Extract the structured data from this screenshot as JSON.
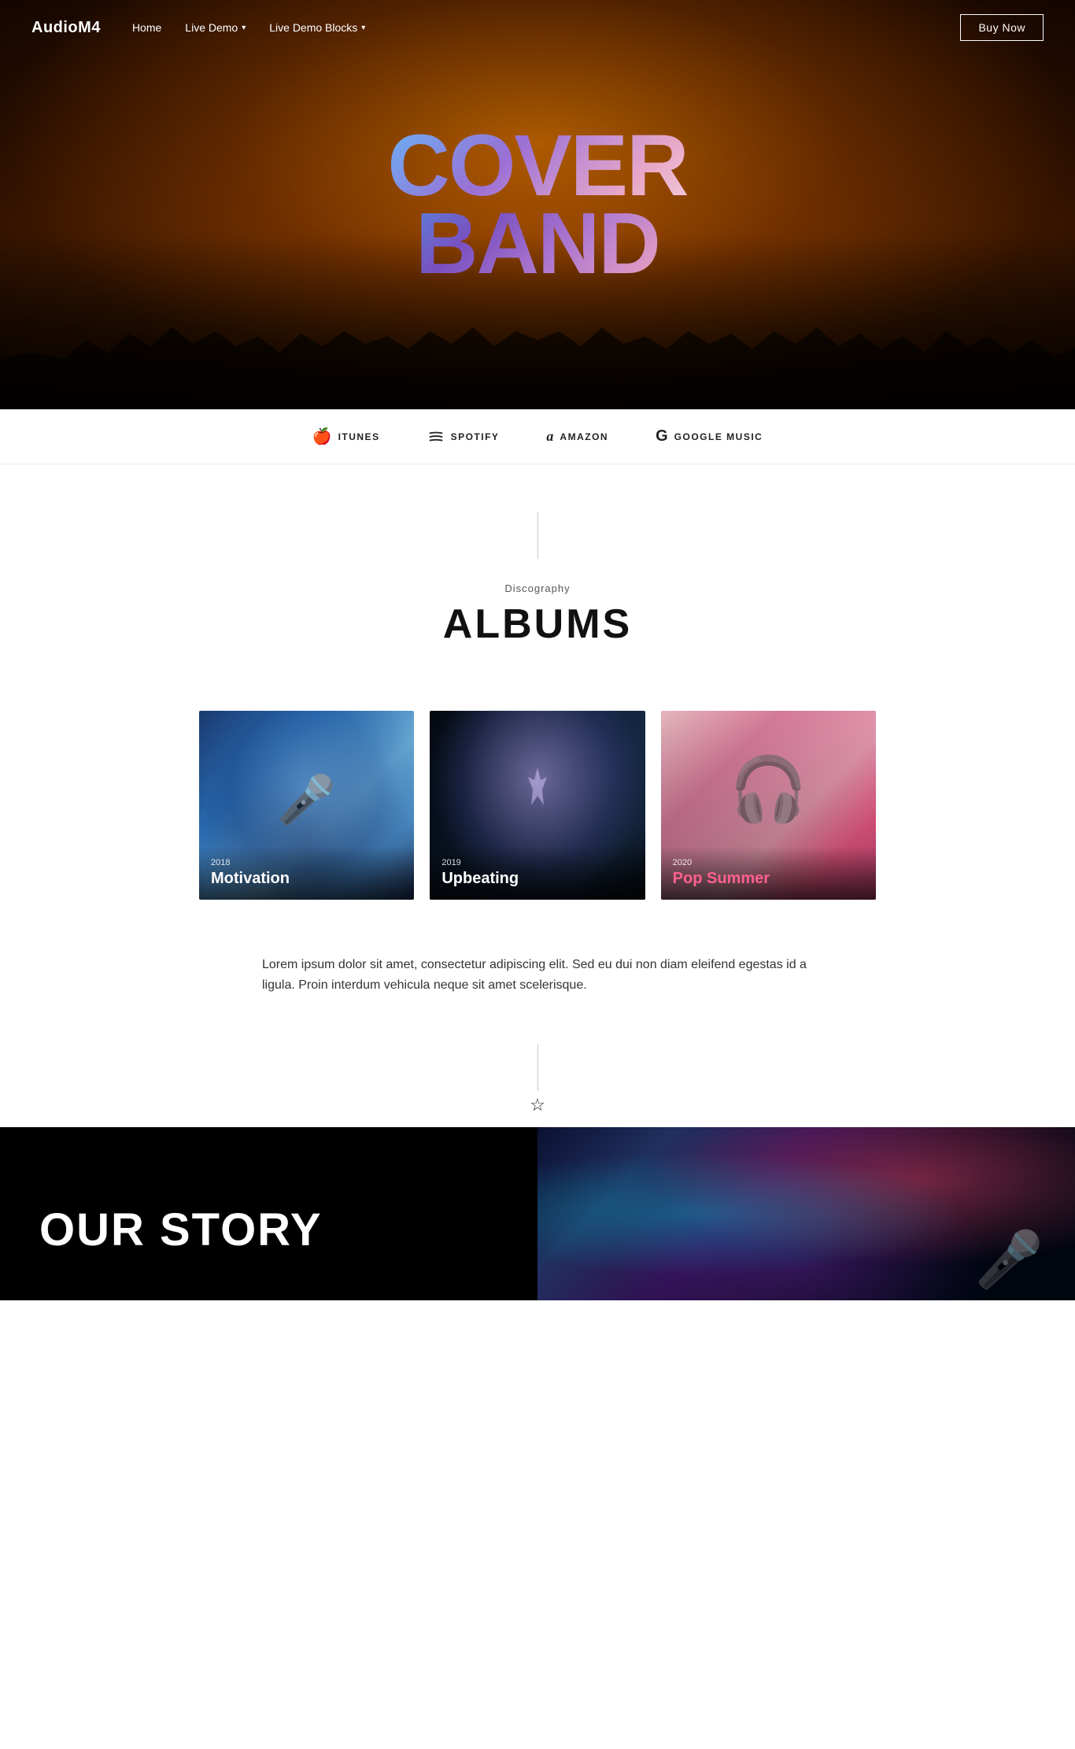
{
  "nav": {
    "logo": "AudioM4",
    "links": [
      {
        "label": "Home",
        "hasDropdown": false
      },
      {
        "label": "Live Demo",
        "hasDropdown": true
      },
      {
        "label": "Live Demo Blocks",
        "hasDropdown": true
      }
    ],
    "buyButton": "Buy Now"
  },
  "hero": {
    "titleLine1": "COVER",
    "titleLine2": "BAND"
  },
  "platforms": [
    {
      "name": "itunes",
      "label": "ITUNES",
      "icon": "🍎"
    },
    {
      "name": "spotify",
      "label": "SPOTIFY",
      "icon": "〰"
    },
    {
      "name": "amazon",
      "label": "AMAZON",
      "icon": "a"
    },
    {
      "name": "googleMusic",
      "label": "GOOGLE MUSIC",
      "icon": "G"
    }
  ],
  "discography": {
    "subtitle": "Discography",
    "title": "ALBUMS"
  },
  "albums": [
    {
      "year": "2018",
      "name": "Motivation",
      "bgClass": "album-bg-1"
    },
    {
      "year": "2019",
      "name": "Upbeating",
      "bgClass": "album-bg-2"
    },
    {
      "year": "2020",
      "name": "Pop Summer",
      "bgClass": "album-bg-3",
      "pinkText": true
    }
  ],
  "description": "Lorem ipsum dolor sit amet, consectetur adipiscing elit. Sed eu dui non diam eleifend egestas id a ligula. Proin interdum vehicula neque sit amet scelerisque.",
  "ourStory": {
    "title": "OUR STORY"
  }
}
